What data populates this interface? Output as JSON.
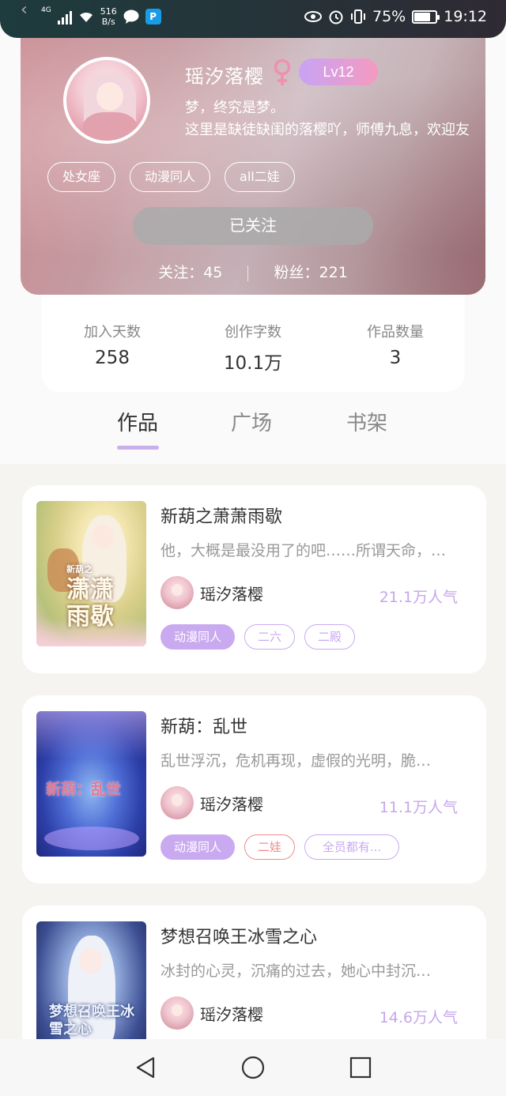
{
  "status_bar": {
    "network": "4G",
    "speed_value": "516",
    "speed_unit": "B/s",
    "battery_percent": "75%",
    "battery_level": 0.75,
    "time": "19:12"
  },
  "profile": {
    "username": "瑶汐落樱",
    "level": "Lv12",
    "bio_line1": "梦，终究是梦。",
    "bio_line2": "这里是缺徒缺闺的落樱吖，师傅九息，欢迎友",
    "tags": [
      "处女座",
      "动漫同人",
      "all二娃"
    ],
    "follow_button": "已关注",
    "following_label": "关注：",
    "following_count": "45",
    "fans_label": "粉丝：",
    "fans_count": "221"
  },
  "stats": [
    {
      "label": "加入天数",
      "value": "258"
    },
    {
      "label": "创作字数",
      "value": "10.1万"
    },
    {
      "label": "作品数量",
      "value": "3"
    }
  ],
  "tabs": [
    "作品",
    "广场",
    "书架"
  ],
  "active_tab": "作品",
  "works": [
    {
      "title": "新葫之萧萧雨歇",
      "description": "他，大概是最没用了的吧……所谓天命，…",
      "author": "瑶汐落樱",
      "popularity": "21.1万人气",
      "cover_text": "潇潇雨歇",
      "cover_subtext": "新葫之",
      "tags": [
        "动漫同人",
        "二六",
        "二殿"
      ]
    },
    {
      "title": "新葫：乱世",
      "description": "乱世浮沉，危机再现，虚假的光明，脆…",
      "author": "瑶汐落樱",
      "popularity": "11.1万人气",
      "cover_text": "新葫：乱世",
      "tags": [
        "动漫同人",
        "二娃",
        "全员都有..."
      ]
    },
    {
      "title": "梦想召唤王冰雪之心",
      "description": "冰封的心灵，沉痛的过去，她心中封沉…",
      "author": "瑶汐落樱",
      "popularity": "14.6万人气",
      "cover_text": "梦想召唤王冰雪之心",
      "tags": []
    }
  ],
  "colors": {
    "accent_purple": "#c9aaf0",
    "tag_red": "#ec8c8c",
    "level_gradient_start": "#c8a3f5",
    "level_gradient_end": "#f59ac0"
  },
  "icons": [
    "signal-icon",
    "wifi-icon",
    "message-icon",
    "app-notification-icon",
    "eye-icon",
    "alarm-icon",
    "vibrate-icon",
    "battery-icon",
    "female-icon",
    "nav-back-icon",
    "nav-home-icon",
    "nav-recents-icon"
  ]
}
